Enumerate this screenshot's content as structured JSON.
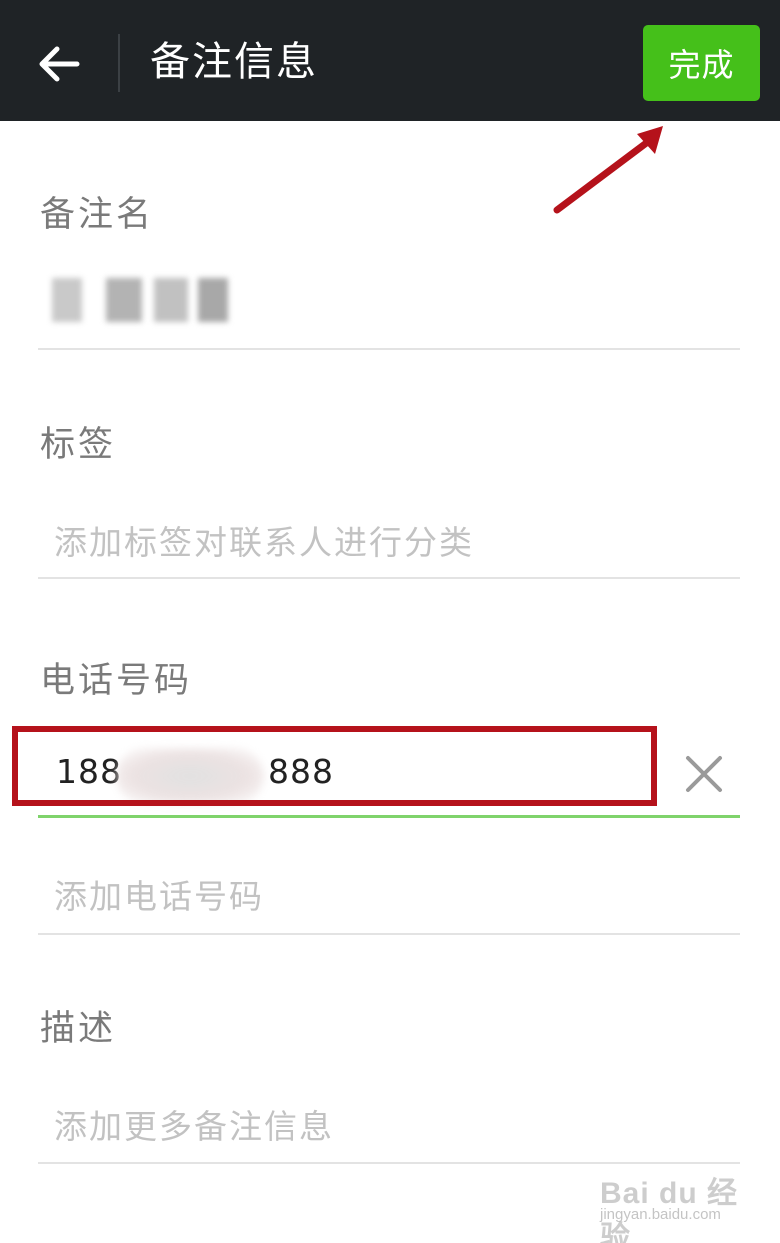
{
  "header": {
    "title": "备注信息",
    "done_label": "完成"
  },
  "remark": {
    "label": "备注名"
  },
  "tags": {
    "label": "标签",
    "placeholder": "添加标签对联系人进行分类"
  },
  "phone": {
    "label": "电话号码",
    "value_prefix": "188",
    "value_suffix": "888",
    "add_placeholder": "添加电话号码"
  },
  "description": {
    "label": "描述",
    "placeholder": "添加更多备注信息"
  },
  "watermark": {
    "main": "Bai du 经验",
    "sub": "jingyan.baidu.com"
  },
  "colors": {
    "topbar": "#1f2326",
    "done_button": "#45c01a",
    "highlight": "#b5121b",
    "active_underline": "#7fd36b"
  },
  "icons": {
    "back": "arrow-left-icon",
    "clear": "close-icon",
    "annotation": "red-arrow-icon"
  }
}
